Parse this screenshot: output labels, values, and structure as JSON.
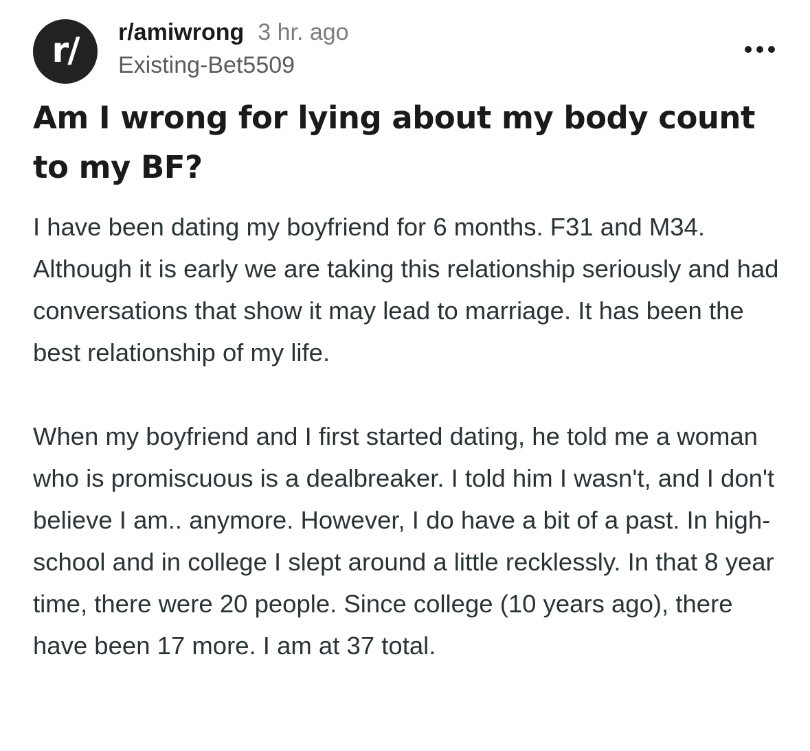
{
  "post": {
    "avatar_glyph": "r/",
    "subreddit": "r/amiwrong",
    "time_ago": "3 hr. ago",
    "author": "Existing-Bet5509",
    "title": "Am I wrong for lying about my body count to my BF?",
    "paragraphs": [
      "I have been dating my boyfriend for 6 months. F31 and M34. Although it is early we are taking this relationship seriously and had conversations that show it may lead to marriage. It has been the best relationship of my life.",
      "When my boyfriend and I first started dating, he told me a woman who is promiscuous is a dealbreaker. I told him I wasn't, and I don't believe I am.. anymore. However, I do have a bit of a past. In high-school and in college I slept around a little recklessly. In that 8 year time, there were 20 people. Since college (10 years ago), there have been 17 more. I am at 37 total."
    ]
  },
  "icons": {
    "avatar": "subreddit-avatar-icon",
    "more": "more-options-icon"
  },
  "colors": {
    "avatar_bg": "#222222",
    "title": "#1a1a1b",
    "body": "#2a3336",
    "muted": "#7c7c7c"
  }
}
